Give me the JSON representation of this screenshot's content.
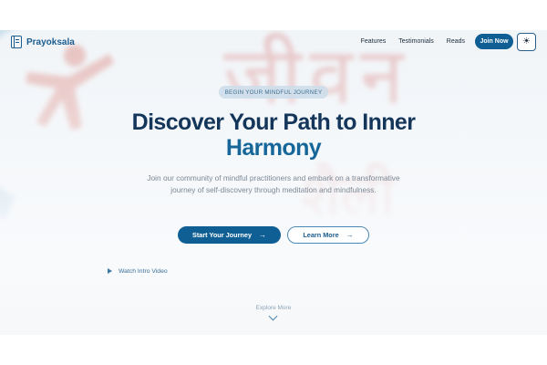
{
  "brand": {
    "name": "Prayoksala"
  },
  "nav": {
    "links": [
      "Features",
      "Testimonials",
      "Reads"
    ],
    "join_label": "Join Now",
    "theme_icon": "sun-icon"
  },
  "hero": {
    "badge": "BEGIN YOUR MINDFUL JOURNEY",
    "title_line1": "Discover Your Path to Inner",
    "title_line2": "Harmony",
    "subtitle": "Join our community of mindful practitioners and embark on a transformative journey of self-discovery through meditation and mindfulness.",
    "primary_cta": "Start Your Journey",
    "secondary_cta": "Learn More",
    "watch_video": "Watch Intro Video",
    "explore": "Explore More"
  },
  "colors": {
    "accent": "#0f5f94",
    "title_dark": "#14365a",
    "title_blue": "#17669a"
  }
}
